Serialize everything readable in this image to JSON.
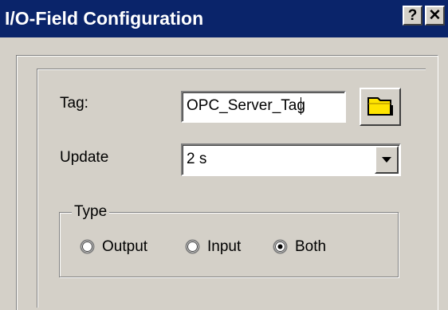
{
  "window": {
    "title": "I/O-Field Configuration",
    "help_label": "?",
    "close_label": "✕"
  },
  "form": {
    "tag_label": "Tag:",
    "tag_value": "OPC_Server_Tag",
    "update_label": "Update",
    "update_value": "2 s"
  },
  "type_group": {
    "title": "Type",
    "options": [
      {
        "label": "Output",
        "selected": false
      },
      {
        "label": "Input",
        "selected": false
      },
      {
        "label": "Both",
        "selected": true
      }
    ]
  },
  "icons": {
    "folder": "folder-icon",
    "dropdown": "chevron-down-icon"
  },
  "colors": {
    "titlebar": "#0a246a",
    "face": "#d4d0c8",
    "folder_fill": "#ffe400"
  }
}
